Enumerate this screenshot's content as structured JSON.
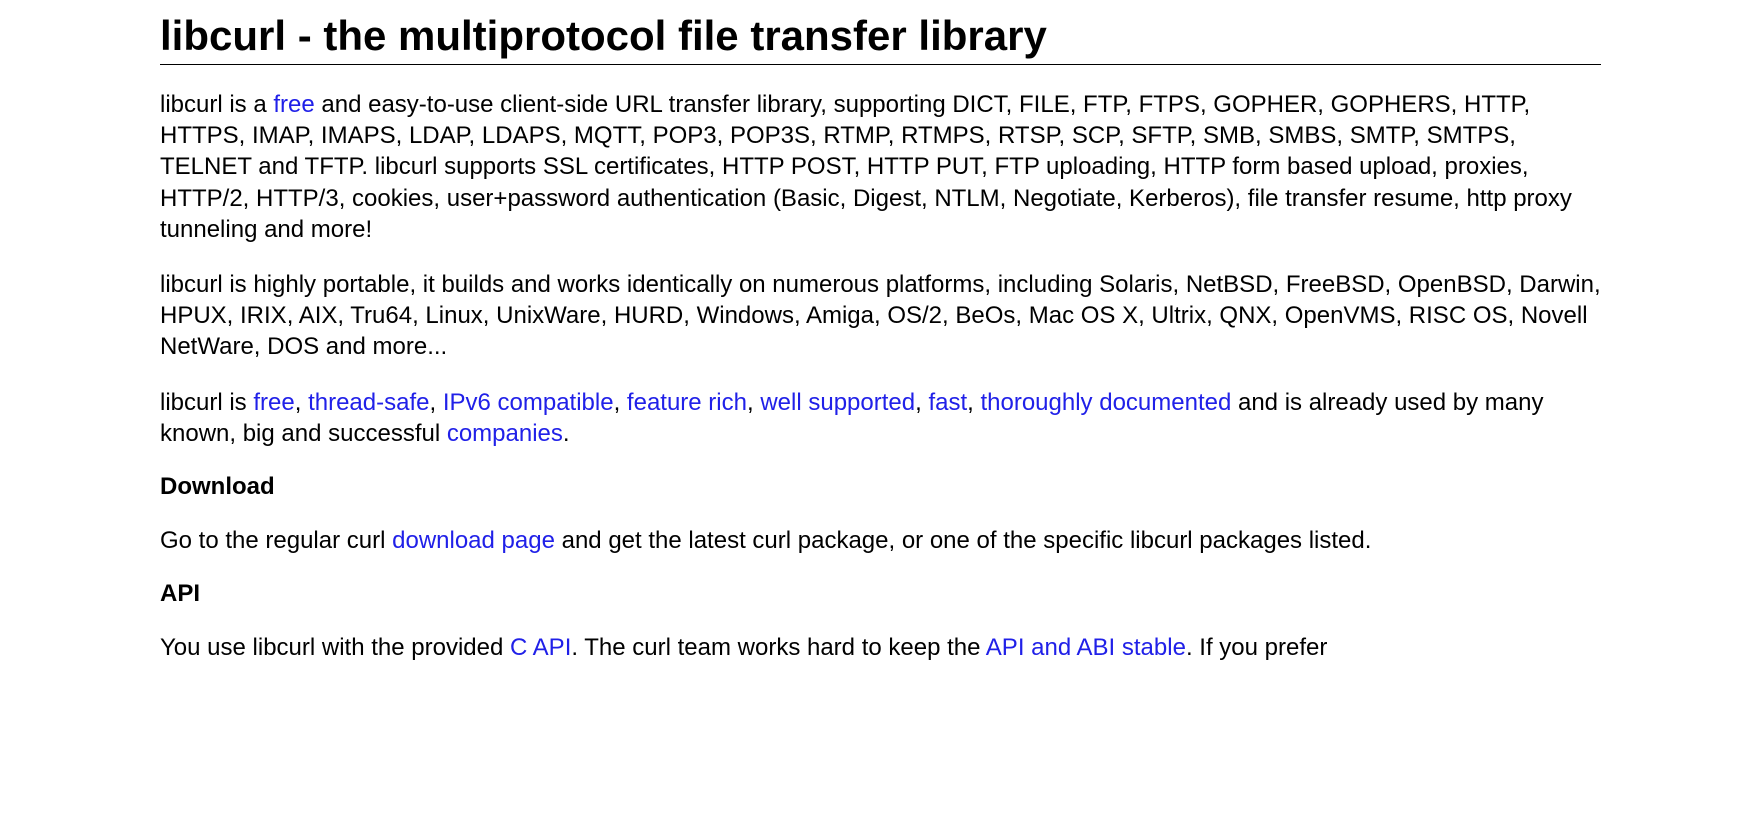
{
  "title": "libcurl - the multiprotocol file transfer library",
  "p1a": "libcurl is a ",
  "link_free1": "free",
  "p1b": " and easy-to-use client-side URL transfer library, supporting DICT, FILE, FTP, FTPS, GOPHER, GOPHERS, HTTP, HTTPS, IMAP, IMAPS, LDAP, LDAPS, MQTT, POP3, POP3S, RTMP, RTMPS, RTSP, SCP, SFTP, SMB, SMBS, SMTP, SMTPS, TELNET and TFTP. libcurl supports SSL certificates, HTTP POST, HTTP PUT, FTP uploading, HTTP form based upload, proxies, HTTP/2, HTTP/3, cookies, user+password authentication (Basic, Digest, NTLM, Negotiate, Kerberos), file transfer resume, http proxy tunneling and more!",
  "p2": "libcurl is highly portable, it builds and works identically on numerous platforms, including Solaris, NetBSD, FreeBSD, OpenBSD, Darwin, HPUX, IRIX, AIX, Tru64, Linux, UnixWare, HURD, Windows, Amiga, OS/2, BeOs, Mac OS X, Ultrix, QNX, OpenVMS, RISC OS, Novell NetWare, DOS and more...",
  "p3a": "libcurl is ",
  "link_free2": "free",
  "sep": ", ",
  "link_threadsafe": "thread-safe",
  "link_ipv6": "IPv6 compatible",
  "link_featurerich": "feature rich",
  "link_wellsupported": "well supported",
  "link_fast": "fast",
  "link_documented": "thoroughly documented",
  "p3b": " and is already used by many known, big and successful ",
  "link_companies": "companies",
  "period": ".",
  "h_download": "Download",
  "p4a": "Go to the regular curl ",
  "link_download": "download page",
  "p4b": " and get the latest curl package, or one of the specific libcurl packages listed.",
  "h_api": "API",
  "p5a": "You use libcurl with the provided ",
  "link_capi": "C API",
  "p5b": ". The curl team works hard to keep the ",
  "link_apistable": "API and ABI stable",
  "p5c": ". If you prefer"
}
